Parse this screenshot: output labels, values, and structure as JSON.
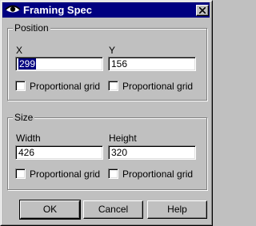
{
  "window": {
    "title": "Framing Spec"
  },
  "position": {
    "label": "Position",
    "x": {
      "label": "X",
      "value": "299",
      "proportional_label": "Proportional grid",
      "checked": false
    },
    "y": {
      "label": "Y",
      "value": "156",
      "proportional_label": "Proportional grid",
      "checked": false
    }
  },
  "size": {
    "label": "Size",
    "width": {
      "label": "Width",
      "value": "426",
      "proportional_label": "Proportional grid",
      "checked": false
    },
    "height": {
      "label": "Height",
      "value": "320",
      "proportional_label": "Proportional grid",
      "checked": false
    }
  },
  "buttons": {
    "ok": "OK",
    "cancel": "Cancel",
    "help": "Help"
  },
  "colors": {
    "titlebar": "#000080",
    "face": "#c0c0c0",
    "selection": "#000080"
  },
  "icons": {
    "title": "eye-icon",
    "close": "close-icon"
  }
}
